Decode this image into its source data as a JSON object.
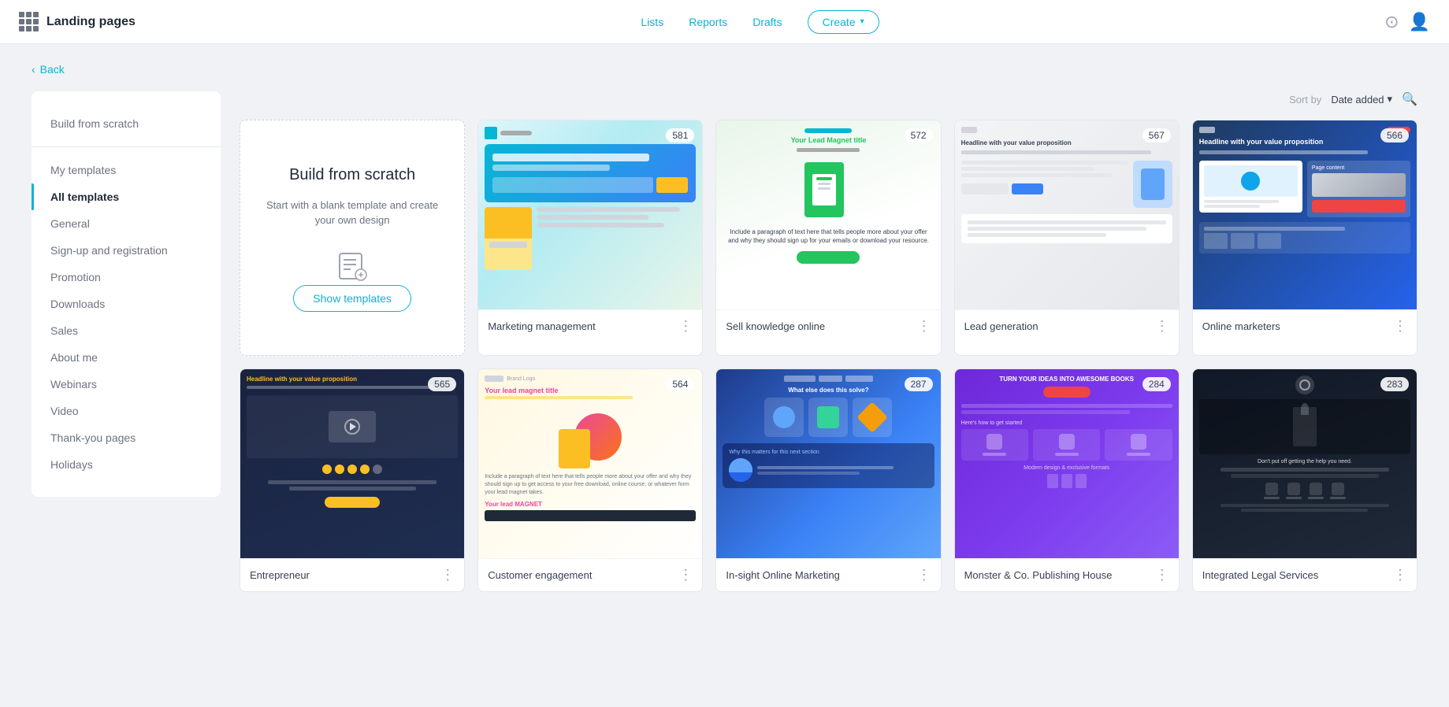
{
  "app": {
    "title": "Landing pages",
    "nav": {
      "lists": "Lists",
      "reports": "Reports",
      "drafts": "Drafts",
      "create": "Create"
    }
  },
  "back_label": "Back",
  "sort": {
    "label": "Sort by",
    "value": "Date added"
  },
  "sidebar": {
    "top_item": "Build from scratch",
    "divider": true,
    "items": [
      {
        "label": "My templates",
        "active": false
      },
      {
        "label": "All templates",
        "active": true
      },
      {
        "label": "General",
        "active": false
      },
      {
        "label": "Sign-up and registration",
        "active": false
      },
      {
        "label": "Promotion",
        "active": false
      },
      {
        "label": "Downloads",
        "active": false
      },
      {
        "label": "Sales",
        "active": false
      },
      {
        "label": "About me",
        "active": false
      },
      {
        "label": "Webinars",
        "active": false
      },
      {
        "label": "Video",
        "active": false
      },
      {
        "label": "Thank-you pages",
        "active": false
      },
      {
        "label": "Holidays",
        "active": false
      }
    ]
  },
  "scratch_card": {
    "title": "Build from scratch",
    "description": "Start with a blank template and create your own design",
    "button": "Show templates"
  },
  "templates_row1": [
    {
      "title": "Marketing management",
      "count": "581",
      "theme": "marketing"
    },
    {
      "title": "Sell knowledge online",
      "count": "572",
      "theme": "sell"
    },
    {
      "title": "Lead generation",
      "count": "567",
      "theme": "lead"
    },
    {
      "title": "Online marketers",
      "count": "566",
      "theme": "online"
    }
  ],
  "templates_row2": [
    {
      "title": "Entrepreneur",
      "count": "565",
      "theme": "entrepreneur"
    },
    {
      "title": "Customer engagement",
      "count": "564",
      "theme": "customer"
    },
    {
      "title": "In-sight Online Marketing",
      "count": "287",
      "theme": "insight"
    },
    {
      "title": "Monster & Co. Publishing House",
      "count": "284",
      "theme": "monster"
    },
    {
      "title": "Integrated Legal Services",
      "count": "283",
      "theme": "legal"
    }
  ]
}
